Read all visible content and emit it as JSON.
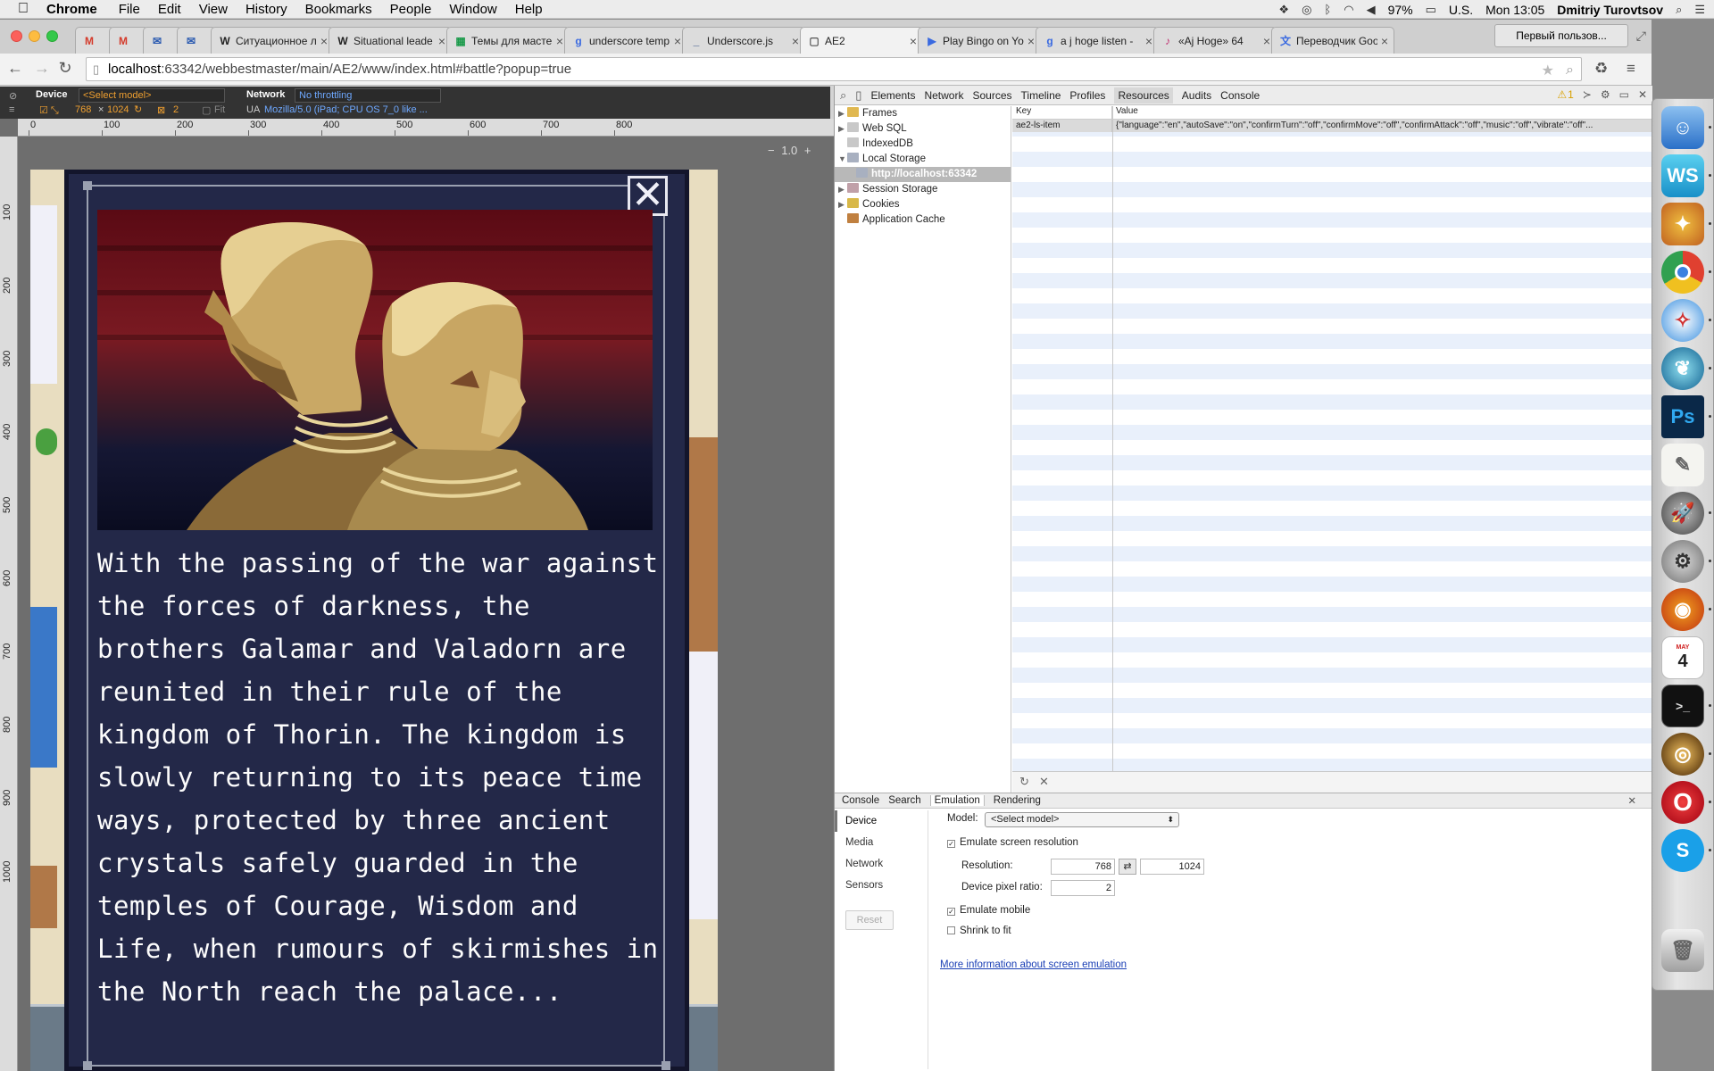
{
  "menubar": {
    "app": "Chrome",
    "items": [
      "File",
      "Edit",
      "View",
      "History",
      "Bookmarks",
      "People",
      "Window",
      "Help"
    ],
    "battery": "97%",
    "input": "U.S.",
    "clock": "Mon 13:05",
    "user": "Dmitriy Turovtsov"
  },
  "tabs": [
    {
      "icon": "M",
      "label": ""
    },
    {
      "icon": "M",
      "label": ""
    },
    {
      "icon": "✉",
      "label": ""
    },
    {
      "icon": "✉",
      "label": ""
    },
    {
      "icon": "W",
      "label": "Ситуационное л"
    },
    {
      "icon": "W",
      "label": "Situational leade"
    },
    {
      "icon": "▦",
      "label": "Темы для масте"
    },
    {
      "icon": "g",
      "label": "underscore temp"
    },
    {
      "icon": "_",
      "label": "Underscore.js"
    },
    {
      "icon": "▢",
      "label": "AE2"
    },
    {
      "icon": "▶",
      "label": "Play Bingo on Yo"
    },
    {
      "icon": "g",
      "label": "a j hoge listen -"
    },
    {
      "icon": "♪",
      "label": "«Aj Hoge» 64"
    },
    {
      "icon": "文",
      "label": "Переводчик Goo"
    }
  ],
  "profile_button": "Первый пользов...",
  "address": {
    "host": "localhost",
    "rest": ":63342/webbestmaster/main/AE2/www/index.html#battle?popup=true"
  },
  "emulation_bar": {
    "device_label": "Device",
    "model": "<Select model>",
    "width": "768",
    "height": "1024",
    "dpr": "2",
    "fit": "Fit",
    "network_label": "Network",
    "throttle": "No throttling",
    "ua_label": "UA",
    "ua_value": "Mozilla/5.0 (iPad; CPU OS 7_0 like ..."
  },
  "ruler_h": [
    "0",
    "100",
    "200",
    "300",
    "400",
    "500",
    "600",
    "700",
    "800"
  ],
  "ruler_v": [
    "100",
    "200",
    "300",
    "400",
    "500",
    "600",
    "700",
    "800",
    "900",
    "1000"
  ],
  "zoom": "1.0",
  "popup": {
    "close_glyph": "✕",
    "story": "With the passing of the war against the forces of darkness, the brothers Galamar and Valadorn are reunited in their rule of the kingdom of Thorin. The kingdom is slowly returning to its peace time ways, protected by three ancient crystals safely guarded in the temples of Courage, Wisdom and Life, when rumours of skirmishes in the North reach the palace..."
  },
  "devtools": {
    "tabs": [
      "Elements",
      "Network",
      "Sources",
      "Timeline",
      "Profiles",
      "Resources",
      "Audits",
      "Console"
    ],
    "warn_count": "1",
    "tree": [
      "Frames",
      "Web SQL",
      "IndexedDB",
      "Local Storage",
      "http://localhost:63342",
      "Session Storage",
      "Cookies",
      "Application Cache"
    ],
    "kv_header": {
      "key": "Key",
      "value": "Value"
    },
    "kv_row": {
      "key": "ae2-ls-item",
      "value": "{\"language\":\"en\",\"autoSave\":\"on\",\"confirmTurn\":\"off\",\"confirmMove\":\"off\",\"confirmAttack\":\"off\",\"music\":\"off\",\"vibrate\":\"off\"..."
    },
    "drawer_tabs": [
      "Console",
      "Search",
      "Emulation",
      "Rendering"
    ],
    "emu_side": [
      "Device",
      "Media",
      "Network",
      "Sensors"
    ],
    "reset": "Reset",
    "model_label": "Model:",
    "model_value": "<Select model>",
    "emulate_resolution": "Emulate screen resolution",
    "resolution_label": "Resolution:",
    "res_w": "768",
    "res_h": "1024",
    "swap_glyph": "⇄",
    "dpr_label": "Device pixel ratio:",
    "dpr_value": "2",
    "emulate_mobile": "Emulate mobile",
    "shrink": "Shrink to fit",
    "more_info": "More information about screen emulation"
  },
  "dock_calendar_day": "4",
  "dock_calendar_month": "MAY"
}
